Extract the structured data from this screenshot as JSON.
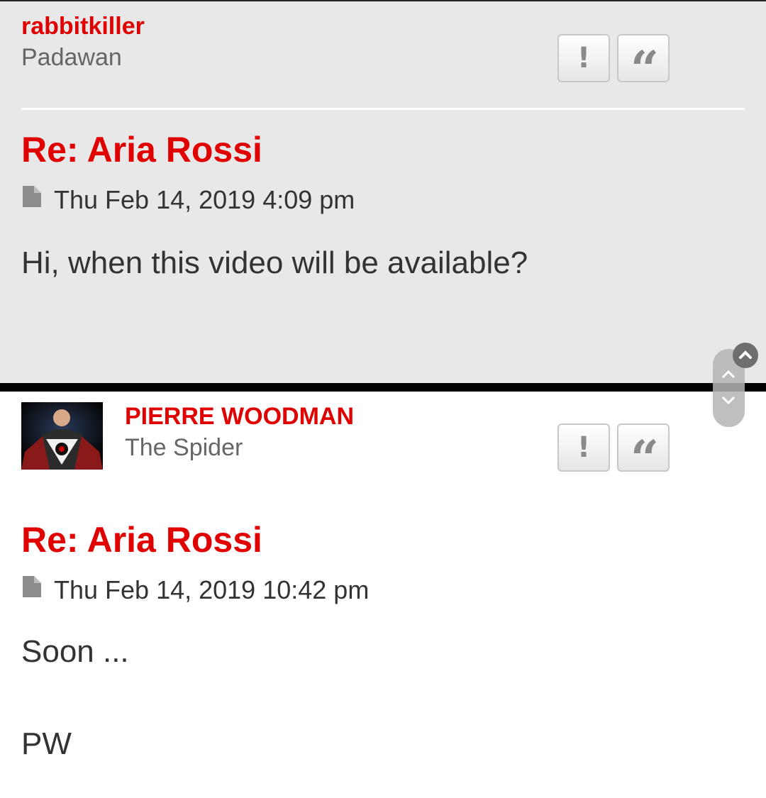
{
  "post1": {
    "username": "rabbitkiller",
    "rank": "Padawan",
    "title": "Re: Aria Rossi",
    "timestamp": "Thu Feb 14, 2019 4:09 pm",
    "body": "Hi, when this video will be available?",
    "report_icon": "exclamation-icon",
    "quote_icon": "quote-icon"
  },
  "post2": {
    "username": "PIERRE WOODMAN",
    "rank": "The Spider",
    "title": "Re: Aria Rossi",
    "timestamp": "Thu Feb 14, 2019 10:42 pm",
    "body_line1": "Soon ...",
    "body_line2": "PW",
    "report_icon": "exclamation-icon",
    "quote_icon": "quote-icon"
  },
  "colors": {
    "accent": "#e00000",
    "post_bg_alt": "#e8e8e8",
    "text": "#333333"
  }
}
